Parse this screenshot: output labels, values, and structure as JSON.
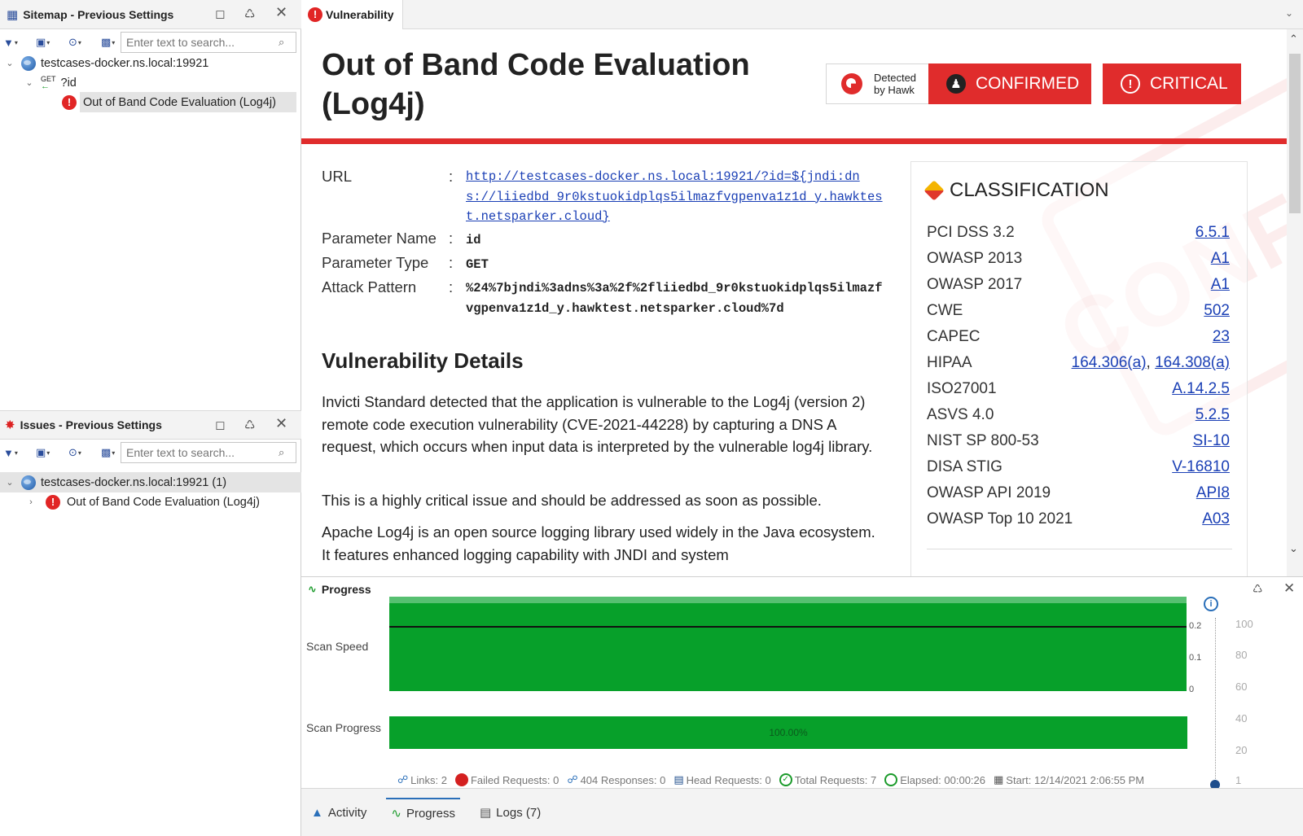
{
  "sitemap": {
    "title": "Sitemap - Previous Settings",
    "search_placeholder": "Enter text to search...",
    "tree": [
      {
        "label": "testcases-docker.ns.local:19921"
      },
      {
        "label": "?id",
        "method": "GET"
      },
      {
        "label": "Out of Band Code Evaluation (Log4j)"
      }
    ]
  },
  "issues": {
    "title": "Issues - Previous Settings",
    "search_placeholder": "Enter text to search...",
    "tree": [
      {
        "label": "testcases-docker.ns.local:19921 (1)"
      },
      {
        "label": "Out of Band Code Evaluation (Log4j)"
      }
    ]
  },
  "tab": {
    "label": "Vulnerability"
  },
  "vuln": {
    "title_line1": "Out of Band Code Evaluation",
    "title_line2": "(Log4j)",
    "hawk_line1": "Detected",
    "hawk_line2": "by Hawk",
    "confirmed": "CONFIRMED",
    "critical": "CRITICAL",
    "stamp_text": "CONFIRMED",
    "fields": {
      "url_label": "URL",
      "url_value": "http://testcases-docker.ns.local:19921/?id=${jndi:dns://liiedbd_9r0kstuokidplqs5ilmazfvgpenva1z1d_y.hawktest.netsparker.cloud}",
      "param_name_label": "Parameter Name",
      "param_name_value": "id",
      "param_type_label": "Parameter Type",
      "param_type_value": "GET",
      "attack_label": "Attack Pattern",
      "attack_value": "%24%7bjndi%3adns%3a%2f%2fliiedbd_9r0kstuokidplqs5ilmazfvgpenva1z1d_y.hawktest.netsparker.cloud%7d",
      "colon": ":"
    },
    "details_heading": "Vulnerability Details",
    "paragraphs": [
      "Invicti Standard detected that the application is vulnerable to the Log4j (version 2) remote code execution vulnerability (CVE-2021-44228) by capturing a DNS A request, which occurs when input data is interpreted by the vulnerable log4j library.",
      "This is a highly critical issue and should be addressed as soon as possible.",
      "Apache Log4j is an open source logging library used widely in the Java ecosystem. It features enhanced logging capability with JNDI and system"
    ]
  },
  "classification": {
    "heading": "CLASSIFICATION",
    "rows": [
      {
        "name": "PCI DSS 3.2",
        "values": [
          "6.5.1"
        ]
      },
      {
        "name": "OWASP 2013",
        "values": [
          "A1"
        ]
      },
      {
        "name": "OWASP 2017",
        "values": [
          "A1"
        ]
      },
      {
        "name": "CWE",
        "values": [
          "502"
        ]
      },
      {
        "name": "CAPEC",
        "values": [
          "23"
        ]
      },
      {
        "name": "HIPAA",
        "values": [
          "164.306(a)",
          "164.308(a)"
        ]
      },
      {
        "name": "ISO27001",
        "values": [
          "A.14.2.5"
        ]
      },
      {
        "name": "ASVS 4.0",
        "values": [
          "5.2.5"
        ]
      },
      {
        "name": "NIST SP 800-53",
        "values": [
          "SI-10"
        ]
      },
      {
        "name": "DISA STIG",
        "values": [
          "V-16810"
        ]
      },
      {
        "name": "OWASP API 2019",
        "values": [
          "API8"
        ]
      },
      {
        "name": "OWASP Top 10 2021",
        "values": [
          "A03"
        ]
      }
    ]
  },
  "progress": {
    "title": "Progress",
    "scan_speed_label": "Scan Speed",
    "scan_progress_label": "Scan Progress",
    "progress_value": "100.00%",
    "progress_fraction": 1.0,
    "speed_ticks": [
      "0.2",
      "0.1",
      "0"
    ],
    "scale_ticks": [
      "100",
      "80",
      "60",
      "40",
      "20",
      "1"
    ],
    "stats": {
      "links": "Links: 2",
      "failed": "Failed Requests: 0",
      "responses404": "404 Responses: 0",
      "head": "Head Requests: 0",
      "total": "Total Requests: 7",
      "elapsed": "Elapsed: 00:00:26",
      "start": "Start: 12/14/2021 2:06:55 PM"
    }
  },
  "bottom_tabs": {
    "activity": "Activity",
    "progress": "Progress",
    "logs": "Logs (7)"
  },
  "colors": {
    "accent_red": "#e02c2c",
    "progress_green": "#07a02a",
    "link_blue": "#1a3fb5"
  }
}
